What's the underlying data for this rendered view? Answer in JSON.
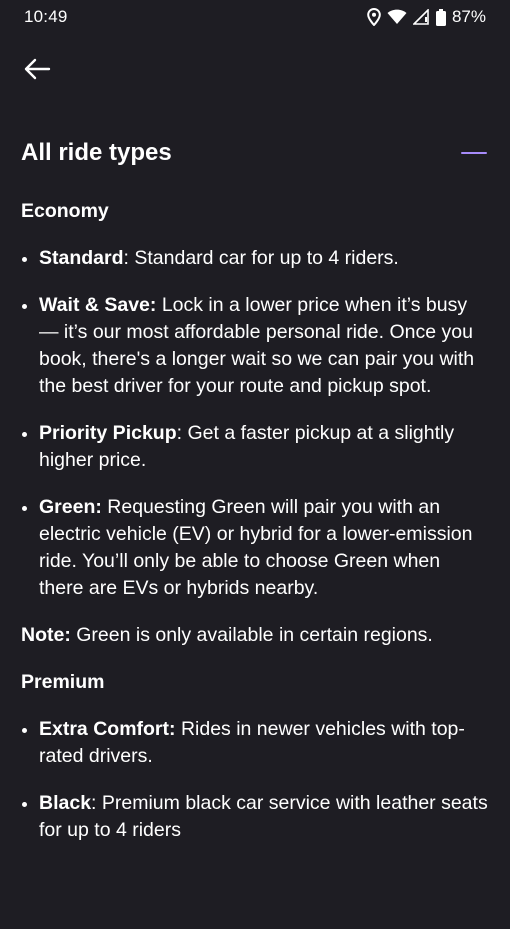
{
  "status_bar": {
    "time": "10:49",
    "battery": "87%",
    "icons": [
      "location-icon",
      "wifi-icon",
      "signal-icon",
      "battery-icon"
    ]
  },
  "nav": {
    "back_icon": "arrow-left-icon"
  },
  "header": {
    "title": "All ride types",
    "collapse_icon": "minus-icon",
    "accent_color": "#a78bfa"
  },
  "sections": {
    "economy": {
      "heading": "Economy",
      "items": [
        {
          "name": "Standard",
          "sep": ": ",
          "description": "Standard car for up to 4 riders."
        },
        {
          "name": "Wait & Save:",
          "sep": " ",
          "description": "Lock in a lower price when it’s busy — it’s our most affordable personal ride. Once you book, there's a longer wait so we can pair you with the best driver for your route and pickup spot."
        },
        {
          "name": "Priority Pickup",
          "sep": ": ",
          "description": "Get a faster pickup at a slightly higher price."
        },
        {
          "name": "Green:",
          "sep": " ",
          "description": "Requesting Green will pair you with an electric vehicle (EV) or hybrid for a lower-emission ride. You’ll only be able to choose Green when there are EVs or hybrids nearby."
        }
      ],
      "note_label": "Note:",
      "note_text": " Green is only available in certain regions."
    },
    "premium": {
      "heading": "Premium",
      "items": [
        {
          "name": "Extra Comfort:",
          "sep": " ",
          "description": "Rides in newer vehicles with top-rated drivers."
        },
        {
          "name": "Black",
          "sep": ": ",
          "description": "Premium black car service with leather seats for up to 4 riders"
        }
      ]
    }
  },
  "colors": {
    "background": "#1e1d23",
    "text": "#ffffff"
  }
}
